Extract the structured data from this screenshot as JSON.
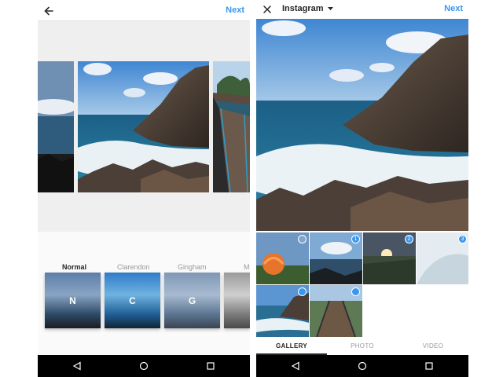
{
  "left_screen": {
    "next_label": "Next",
    "filters": [
      {
        "name": "Normal",
        "letter": "N",
        "active": true
      },
      {
        "name": "Clarendon",
        "letter": "C",
        "active": false
      },
      {
        "name": "Gingham",
        "letter": "G",
        "active": false
      },
      {
        "name": "Mo",
        "letter": "",
        "active": false
      }
    ]
  },
  "right_screen": {
    "title": "Instagram",
    "next_label": "Next",
    "selection_badges": [
      "",
      "1",
      "2",
      "3",
      "",
      ""
    ],
    "tabs": [
      {
        "label": "GALLERY",
        "active": true
      },
      {
        "label": "PHOTO",
        "active": false
      },
      {
        "label": "VIDEO",
        "active": false
      }
    ]
  },
  "colors": {
    "accent": "#3897f0",
    "nav_bar": "#000000",
    "sea": "#1f6f94",
    "sky": "#5b9ad6",
    "rock": "#4a3e36"
  }
}
